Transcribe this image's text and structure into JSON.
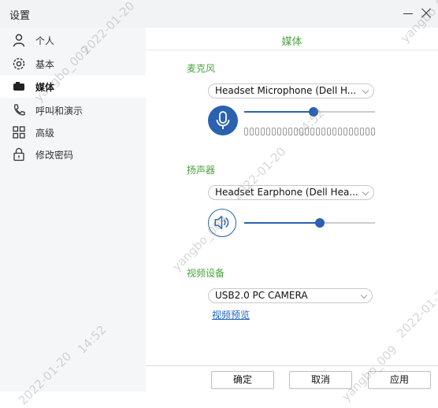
{
  "window": {
    "title": "设置"
  },
  "sidebar": {
    "items": [
      {
        "label": "个人",
        "icon": "person-icon",
        "active": false
      },
      {
        "label": "基本",
        "icon": "gear-icon",
        "active": false
      },
      {
        "label": "媒体",
        "icon": "media-icon",
        "active": true
      },
      {
        "label": "呼叫和演示",
        "icon": "phone-icon",
        "active": false
      },
      {
        "label": "高级",
        "icon": "grid-icon",
        "active": false
      },
      {
        "label": "修改密码",
        "icon": "lock-icon",
        "active": false
      }
    ]
  },
  "main": {
    "header": "媒体",
    "microphone": {
      "label": "麦克风",
      "device": "Headset Microphone (Dell H...",
      "volume": 0.53,
      "level_segments": 24
    },
    "speaker": {
      "label": "扬声器",
      "device": "Headset Earphone (Dell Hea...",
      "volume": 0.58
    },
    "video": {
      "label": "视频设备",
      "device": "USB2.0 PC CAMERA",
      "preview_link": "视频预览"
    }
  },
  "footer": {
    "ok": "确定",
    "cancel": "取消",
    "apply": "应用"
  },
  "watermark": {
    "texts": [
      "yangbo_009",
      "2022-01-20",
      "14:52"
    ]
  },
  "colors": {
    "accent": "#2a62b0",
    "section_title": "#4aa33d",
    "link": "#1e64c8"
  }
}
